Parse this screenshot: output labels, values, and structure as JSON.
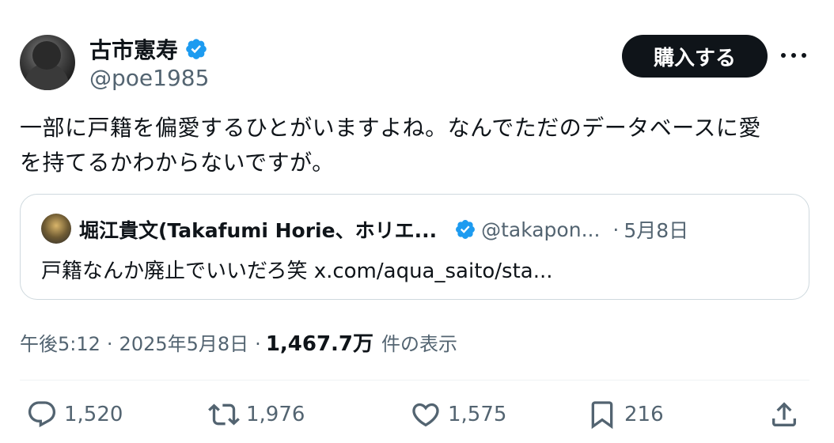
{
  "author": {
    "display_name": "古市憲寿",
    "handle": "@poe1985",
    "verified": true
  },
  "buy_button": {
    "label": "購入する"
  },
  "more_button": {
    "icon": "more-dots-icon"
  },
  "tweet": {
    "text_line1": "一部に戸籍を偏愛するひとがいますよね。なんでただのデータベースに愛",
    "text_line2": "を持てるかわからないですが。"
  },
  "quoted_tweet": {
    "display_name": "堀江貴文(Takafumi Horie、ホリエ...",
    "handle": "@takapon...",
    "separator": "·",
    "date": "5月8日",
    "text": "戸籍なんか廃止でいいだろ笑 x.com/aqua_saito/sta..."
  },
  "meta": {
    "time": "午後5:12",
    "sep1": "·",
    "date": "2025年5月8日",
    "sep2": "·",
    "views": "1,467.7万",
    "views_label": "件の表示"
  },
  "actions": {
    "replies": "1,520",
    "retweets": "1,976",
    "likes": "1,575",
    "bookmarks": "216"
  },
  "colors": {
    "primary_text": "#0f1419",
    "secondary_text": "#536471",
    "verified_blue": "#1d9bf0",
    "border": "#cfd9de"
  }
}
